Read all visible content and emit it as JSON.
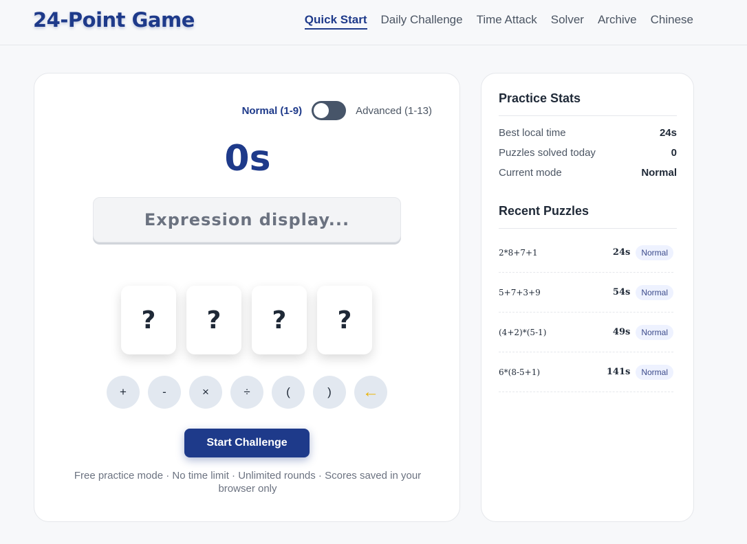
{
  "header": {
    "logo": "24-Point Game",
    "nav": [
      "Quick Start",
      "Daily Challenge",
      "Time Attack",
      "Solver",
      "Archive",
      "Chinese"
    ]
  },
  "game": {
    "mode_normal": "Normal (1-9)",
    "mode_advanced": "Advanced (1-13)",
    "timer": "0s",
    "expression_placeholder": "Expression display...",
    "cards": [
      "?",
      "?",
      "?",
      "?"
    ],
    "operators": [
      "+",
      "-",
      "×",
      "÷",
      "(",
      ")",
      "←"
    ],
    "start_label": "Start Challenge",
    "footnote": "Free practice mode · No time limit · Unlimited rounds · Scores saved in your browser only"
  },
  "stats": {
    "title": "Practice Stats",
    "rows": [
      {
        "label": "Best local time",
        "value": "24s"
      },
      {
        "label": "Puzzles solved today",
        "value": "0"
      },
      {
        "label": "Current mode",
        "value": "Normal"
      }
    ]
  },
  "recent": {
    "title": "Recent Puzzles",
    "items": [
      {
        "expr": "2*8+7+1",
        "time": "24s",
        "mode": "Normal"
      },
      {
        "expr": "5+7+3+9",
        "time": "54s",
        "mode": "Normal"
      },
      {
        "expr": "(4+2)*(5-1)",
        "time": "49s",
        "mode": "Normal"
      },
      {
        "expr": "6*(8-5+1)",
        "time": "141s",
        "mode": "Normal"
      }
    ]
  }
}
